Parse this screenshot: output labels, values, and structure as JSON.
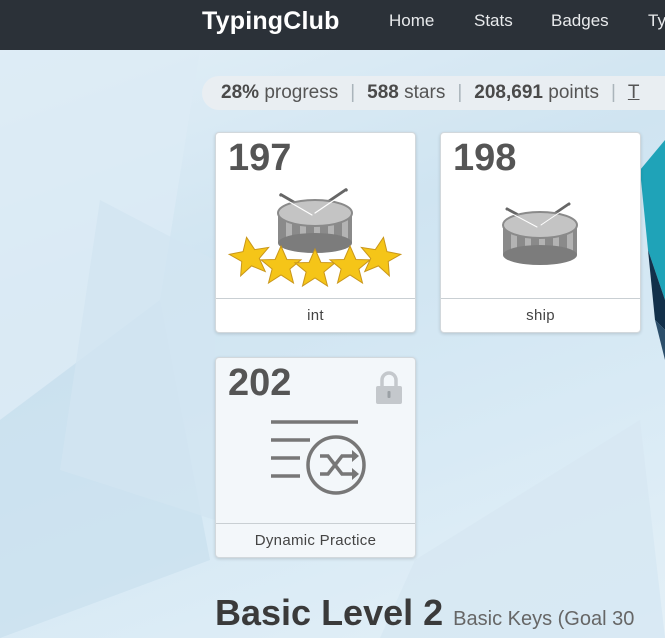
{
  "header": {
    "brand": "TypingClub",
    "nav": [
      "Home",
      "Stats",
      "Badges",
      "Ty"
    ]
  },
  "stats": {
    "progress_value": "28%",
    "progress_label": "progress",
    "stars_value": "588",
    "stars_label": "stars",
    "points_value": "208,691",
    "points_label": "points",
    "separator": "|",
    "trailing": "T"
  },
  "lessons": [
    {
      "number": "197",
      "label": "int",
      "stars": 5,
      "icon": "drum-icon",
      "locked": false
    },
    {
      "number": "198",
      "label": "ship",
      "stars": 0,
      "icon": "drum-icon",
      "locked": false
    },
    {
      "number": "202",
      "label": "Dynamic Practice",
      "stars": 0,
      "icon": "dynamic-practice-icon",
      "locked": true
    }
  ],
  "section": {
    "title": "Basic Level 2",
    "subtitle": "Basic Keys (Goal 30"
  },
  "colors": {
    "topbar": "#2b3138",
    "star": "#f5c518",
    "teal_shape": "#1fa3b8"
  }
}
